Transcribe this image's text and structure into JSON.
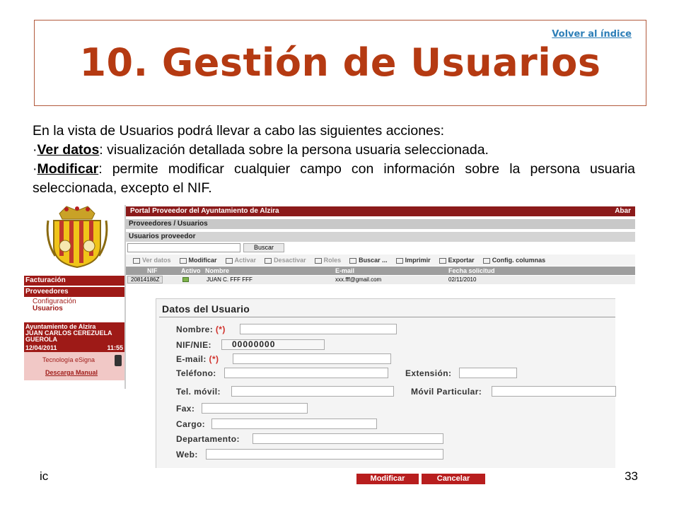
{
  "header": {
    "back_link": "Volver al índice",
    "title": "10. Gestión de Usuarios"
  },
  "intro": {
    "lead": "En la vista de Usuarios podrá llevar a cabo las siguientes acciones:",
    "bullet1_prefix": "·",
    "bullet1_term": "Ver datos",
    "bullet1_rest": ": visualización detallada sobre la persona usuaria seleccionada.",
    "bullet2_prefix": "·",
    "bullet2_term": "Modificar",
    "bullet2_rest": ": permite modificar cualquier campo con información sobre la persona usuaria seleccionada, excepto el NIF."
  },
  "app": {
    "portal_title": "Portal Proveedor del Ayuntamiento de Alzira",
    "portal_right": "Abar",
    "breadcrumb": "Proveedores / Usuarios",
    "section": "Usuarios proveedor",
    "search_button": "Buscar",
    "sidebar": {
      "facturacion": "Facturación",
      "proveedores": "Proveedores",
      "configuracion": "Configuración",
      "usuarios": "Usuarios",
      "org": "Ayuntamiento de Alzira",
      "user_line1": "JUAN CARLOS CEREZUELA",
      "user_line2": "GUEROLA",
      "date": "12/04/2011",
      "time": "11:55",
      "esigna": "Tecnología eSigna",
      "manual": "Descarga Manual"
    },
    "toolbar": [
      "Ver datos",
      "Modificar",
      "Activar",
      "Desactivar",
      "Roles",
      "Buscar ...",
      "Imprimir",
      "Exportar",
      "Config. columnas"
    ],
    "grid": {
      "headers": [
        "NIF",
        "Activo",
        "Nombre",
        "E-mail",
        "Fecha solicitud"
      ],
      "row": {
        "nif": "20814186Z",
        "nombre": "JUAN C. FFF FFF",
        "email": "xxx.fff@gmail.com",
        "fecha": "02/11/2010"
      }
    },
    "form": {
      "title": "Datos del Usuario",
      "req_mark": "(*)",
      "nombre": "Nombre:",
      "nif": "NIF/NIE:",
      "nif_value": "00000000",
      "email": "E-mail:",
      "telefono": "Teléfono:",
      "extension": "Extensión:",
      "tel_movil": "Tel. móvil:",
      "movil_particular": "Móvil Particular:",
      "fax": "Fax:",
      "cargo": "Cargo:",
      "departamento": "Departamento:",
      "web": "Web:"
    },
    "buttons": {
      "modificar": "Modificar",
      "cancelar": "Cancelar"
    }
  },
  "footer": {
    "left": "ic",
    "page": "33"
  }
}
